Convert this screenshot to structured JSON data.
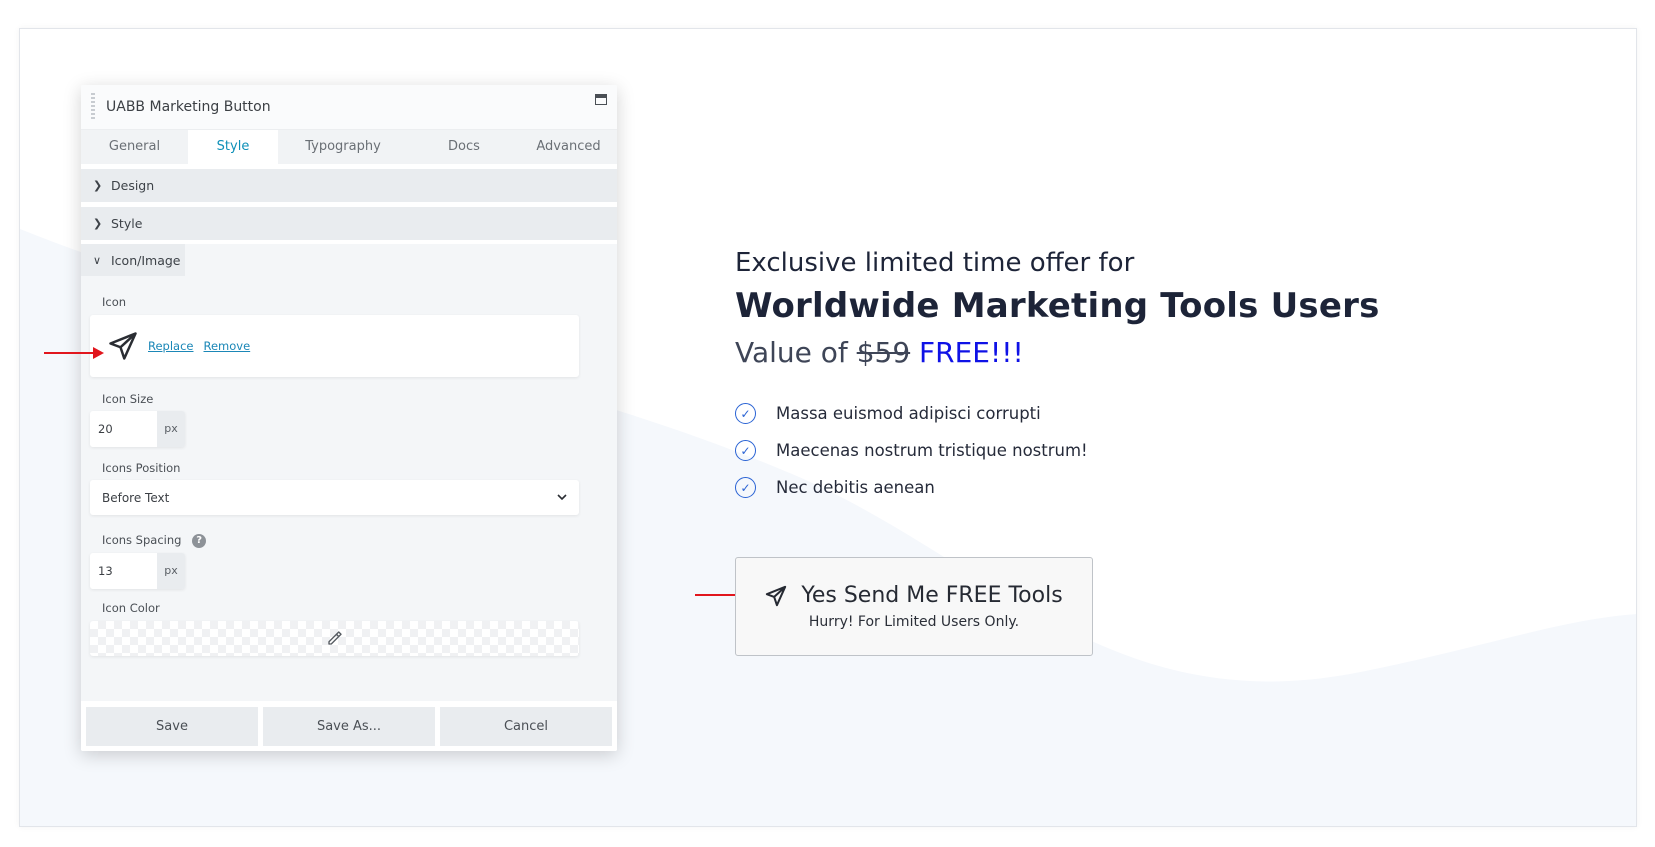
{
  "panel": {
    "title": "UABB Marketing Button",
    "tabs": [
      "General",
      "Style",
      "Typography",
      "Docs",
      "Advanced"
    ],
    "active_tab": "Style",
    "sections": [
      "Design",
      "Style",
      "Icon/Image"
    ],
    "icon_label": "Icon",
    "icon_links": {
      "replace": "Replace",
      "remove": "Remove"
    },
    "icon_size_label": "Icon Size",
    "icon_size_value": "20",
    "icon_size_unit": "px",
    "icons_position_label": "Icons Position",
    "icons_position_value": "Before Text",
    "icons_spacing_label": "Icons Spacing",
    "icons_spacing_help": "?",
    "icons_spacing_value": "13",
    "icons_spacing_unit": "px",
    "icon_color_label": "Icon Color",
    "footer_buttons": {
      "save": "Save",
      "save_as": "Save As...",
      "cancel": "Cancel"
    }
  },
  "promo": {
    "line1": "Exclusive limited time offer for",
    "line2": "Worldwide Marketing Tools Users",
    "line3_prefix": "Value of",
    "line3_price": "$59",
    "line3_free": "FREE!!!",
    "checklist": [
      "Massa euismod adipisci corrupti",
      "Maecenas nostrum tristique nostrum!",
      "Nec debitis aenean"
    ],
    "cta_main": "Yes Send Me FREE Tools",
    "cta_sub": "Hurry! For Limited Users Only."
  },
  "colors": {
    "accent_blue": "#0f12e6",
    "tab_active": "#0e90b8",
    "arrow_red": "#e1161d",
    "check_blue": "#2a63d4"
  }
}
